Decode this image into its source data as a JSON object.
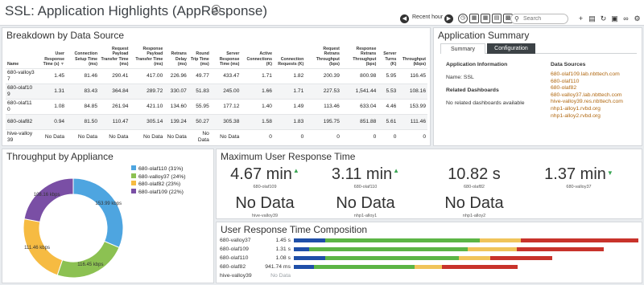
{
  "header": {
    "title": "SSL: Application Highlights (AppResponse)",
    "time_range": "Recent hour",
    "search_placeholder": "Search"
  },
  "breakdown": {
    "title": "Breakdown by Data Source",
    "columns": [
      "Name",
      "User Response Time (s)",
      "Connection Setup Time (ms)",
      "Request Payload Transfer Time (ms)",
      "Response Payload Transfer Time (ms)",
      "Retrans Delay (ms)",
      "Round Trip Time (ms)",
      "Server Response Time (ms)",
      "Active Connections (K)",
      "Connection Requests (K)",
      "Request Retrans Throughput (bps)",
      "Response Retrans Throughput (bps)",
      "Server Turns (K)",
      "Throughput (kbps)"
    ],
    "rows": [
      [
        "680-valloy37",
        "1.45",
        "81.46",
        "290.41",
        "417.00",
        "226.96",
        "49.77",
        "433.47",
        "1.71",
        "1.82",
        "200.39",
        "800.98",
        "5.95",
        "116.45"
      ],
      [
        "680-olaf109",
        "1.31",
        "83.43",
        "364.84",
        "289.72",
        "330.07",
        "51.83",
        "245.00",
        "1.66",
        "1.71",
        "227.53",
        "1,541.44",
        "5.53",
        "108.16"
      ],
      [
        "680-olaf110",
        "1.08",
        "84.85",
        "261.94",
        "421.10",
        "134.60",
        "55.95",
        "177.12",
        "1.40",
        "1.49",
        "113.46",
        "633.04",
        "4.46",
        "153.99"
      ],
      [
        "680-olaf82",
        "0.94",
        "81.50",
        "110.47",
        "305.14",
        "139.24",
        "50.27",
        "305.38",
        "1.58",
        "1.83",
        "195.75",
        "851.88",
        "5.61",
        "111.46"
      ],
      [
        "hive-valloy39",
        "No Data",
        "No Data",
        "No Data",
        "No Data",
        "No Data",
        "No Data",
        "No Data",
        "0",
        "0",
        "0",
        "0",
        "0",
        "0"
      ]
    ]
  },
  "summary": {
    "title": "Application Summary",
    "tabs": [
      "Summary",
      "Configuration"
    ],
    "app_info_heading": "Application Information",
    "name_line": "Name: SSL",
    "related_heading": "Related Dashboards",
    "related_text": "No related dashboards available",
    "data_sources_heading": "Data Sources",
    "data_sources": [
      "680-olaf109.lab.nbttech.com",
      "680-olaf110",
      "680-olaf82",
      "680-valloy37.lab.nbttech.com",
      "hive-valloy39.res.nbttech.com",
      "nhp1-alloy1.rvbd.org",
      "nhp1-alloy2.rvbd.org"
    ]
  },
  "throughput": {
    "title": "Throughput by Appliance",
    "legend": [
      {
        "label": "680-olaf110 (31%)",
        "color": "#4ea5e0"
      },
      {
        "label": "680-valloy37 (24%)",
        "color": "#8cc152"
      },
      {
        "label": "680-olaf82 (23%)",
        "color": "#f6bb42"
      },
      {
        "label": "680-olaf109 (22%)",
        "color": "#7a4fa5"
      }
    ],
    "slices": [
      {
        "value": 153.99,
        "label": "153.99 kbps",
        "color": "#4ea5e0"
      },
      {
        "value": 116.45,
        "label": "116.45 kbps",
        "color": "#8cc152"
      },
      {
        "value": 111.46,
        "label": "111.46 kbps",
        "color": "#f6bb42"
      },
      {
        "value": 108.16,
        "label": "108.16 kbps",
        "color": "#7a4fa5"
      }
    ]
  },
  "max_response": {
    "title": "Maximum User Response Time",
    "metrics": [
      {
        "value": "4.67 min",
        "trend": "up",
        "label": "680-olaf109"
      },
      {
        "value": "3.11 min",
        "trend": "up",
        "label": "680-olaf110"
      },
      {
        "value": "10.82 s",
        "trend": "",
        "label": "680-olaf82"
      },
      {
        "value": "1.37 min",
        "trend": "down",
        "label": "680-valloy37"
      }
    ],
    "nodata": [
      {
        "value": "No Data",
        "label": "hive-valloy39"
      },
      {
        "value": "No Data",
        "label": "nhp1-alloy1"
      },
      {
        "value": "No Data",
        "label": "nhp1-alloy2"
      }
    ]
  },
  "composition": {
    "title": "User Response Time Composition",
    "colors": {
      "blue": "#1f4fa8",
      "green": "#5cb545",
      "yellow": "#f0c45a",
      "red": "#c8332b"
    },
    "rows": [
      {
        "name": "680-valloy37",
        "value": "1.45 s",
        "segments": [
          0.09,
          0.45,
          0.12,
          0.34
        ],
        "scale": 1.0
      },
      {
        "name": "680-olaf109",
        "value": "1.31 s",
        "segments": [
          0.05,
          0.51,
          0.16,
          0.28
        ],
        "scale": 0.9
      },
      {
        "name": "680-olaf110",
        "value": "1.08 s",
        "segments": [
          0.12,
          0.52,
          0.12,
          0.24
        ],
        "scale": 0.75
      },
      {
        "name": "680-olaf82",
        "value": "941.74 ms",
        "segments": [
          0.09,
          0.45,
          0.12,
          0.34
        ],
        "scale": 0.65
      },
      {
        "name": "hive-valloy39",
        "value": "No Data",
        "segments": [],
        "scale": 0
      }
    ]
  }
}
